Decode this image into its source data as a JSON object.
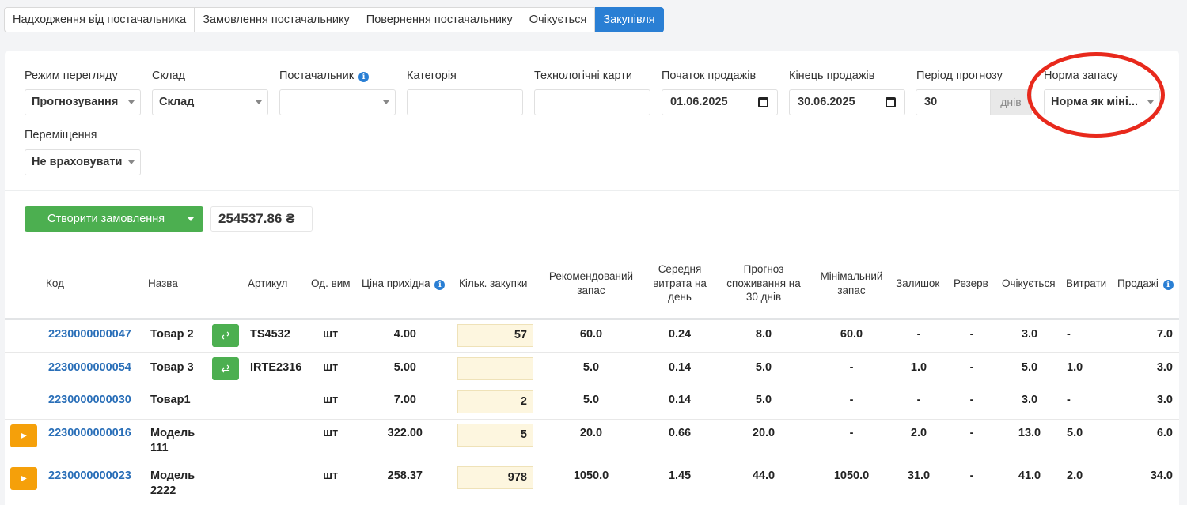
{
  "tabs": [
    {
      "label": "Надходження від постачальника"
    },
    {
      "label": "Замовлення постачальнику"
    },
    {
      "label": "Повернення постачальнику"
    },
    {
      "label": "Очікується"
    },
    {
      "label": "Закупівля",
      "active": true
    }
  ],
  "filters": {
    "view_mode": {
      "label": "Режим перегляду",
      "value": "Прогнозування"
    },
    "warehouse": {
      "label": "Склад",
      "value": "Склад"
    },
    "supplier": {
      "label": "Постачальник",
      "value": ""
    },
    "category": {
      "label": "Категорія",
      "value": ""
    },
    "tech_cards": {
      "label": "Технологічні карти",
      "value": ""
    },
    "sales_start": {
      "label": "Початок продажів",
      "value": "01.06.2025"
    },
    "sales_end": {
      "label": "Кінець продажів",
      "value": "30.06.2025"
    },
    "forecast_period": {
      "label": "Період прогнозу",
      "value": "30",
      "unit": "днів"
    },
    "stock_norm": {
      "label": "Норма запасу",
      "value": "Норма як міні..."
    },
    "transfers": {
      "label": "Переміщення",
      "value": "Не враховувати"
    }
  },
  "actions": {
    "create_order_label": "Створити замовлення",
    "total": "254537.86 ₴"
  },
  "table": {
    "columns": {
      "code": "Код",
      "name": "Назва",
      "article": "Артикул",
      "unit": "Од. вим",
      "price": "Ціна прихідна",
      "qty": "Кільк. закупки",
      "recommended": "Рекомендований запас",
      "avg": "Середня витрата на день",
      "forecast": "Прогноз споживання на 30 днів",
      "min": "Мінімальний запас",
      "balance": "Залишок",
      "reserve": "Резерв",
      "expected": "Очікується",
      "expenses": "Витрати",
      "sales": "Продажі"
    },
    "rows": [
      {
        "code": "2230000000047",
        "name": "Товар 2",
        "article": "TS4532",
        "unit": "шт",
        "price": "4.00",
        "qty": "57",
        "recommended": "60.0",
        "avg": "0.24",
        "forecast": "8.0",
        "min": "60.0",
        "balance": "-",
        "reserve": "-",
        "expected": "3.0",
        "expenses": "-",
        "sales": "7.0"
      },
      {
        "code": "2230000000054",
        "name": "Товар 3",
        "article": "IRTE2316",
        "unit": "шт",
        "price": "5.00",
        "qty": "",
        "recommended": "5.0",
        "avg": "0.14",
        "forecast": "5.0",
        "min": "-",
        "balance": "1.0",
        "reserve": "-",
        "expected": "5.0",
        "expenses": "1.0",
        "sales": "3.0"
      },
      {
        "code": "2230000000030",
        "name": "Товар1",
        "article": "",
        "unit": "шт",
        "price": "7.00",
        "qty": "2",
        "recommended": "5.0",
        "avg": "0.14",
        "forecast": "5.0",
        "min": "-",
        "balance": "-",
        "reserve": "-",
        "expected": "3.0",
        "expenses": "-",
        "sales": "3.0"
      },
      {
        "code": "2230000000016",
        "name1": "Модель",
        "name2": "111",
        "article": "",
        "unit": "шт",
        "price": "322.00",
        "qty": "5",
        "recommended": "20.0",
        "avg": "0.66",
        "forecast": "20.0",
        "min": "-",
        "balance": "2.0",
        "reserve": "-",
        "expected": "13.0",
        "expenses": "5.0",
        "sales": "6.0"
      },
      {
        "code": "2230000000023",
        "name1": "Модель",
        "name2": "2222",
        "article": "",
        "unit": "шт",
        "price": "258.37",
        "qty": "978",
        "recommended": "1050.0",
        "avg": "1.45",
        "forecast": "44.0",
        "min": "1050.0",
        "balance": "31.0",
        "reserve": "-",
        "expected": "41.0",
        "expenses": "2.0",
        "sales": "34.0"
      }
    ]
  },
  "colors": {
    "accent": "#2a7fd4",
    "success": "#4caf50",
    "warning": "#f5a00a",
    "highlight": "#e8291c",
    "qty_bg": "#fdf6df"
  }
}
